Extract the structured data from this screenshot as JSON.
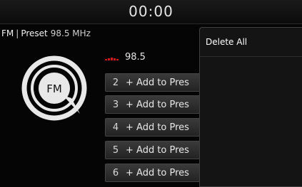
{
  "header": {
    "clock": "00:00"
  },
  "status": {
    "band": "FM",
    "separator": "|",
    "mode": "Preset",
    "frequency": "98.5 MHz"
  },
  "logo": {
    "text": "FM"
  },
  "now_playing": {
    "frequency": "98.5",
    "signal_icon": "signal-strength-icon",
    "signal_color": "#d11a1a"
  },
  "presets": [
    {
      "number": "2",
      "label": "+ Add to Pres"
    },
    {
      "number": "3",
      "label": "+ Add to Pres"
    },
    {
      "number": "4",
      "label": "+ Add to Pres"
    },
    {
      "number": "5",
      "label": "+ Add to Pres"
    },
    {
      "number": "6",
      "label": "+ Add to Pres"
    }
  ],
  "menu": {
    "items": [
      {
        "label": "Delete All"
      }
    ]
  }
}
